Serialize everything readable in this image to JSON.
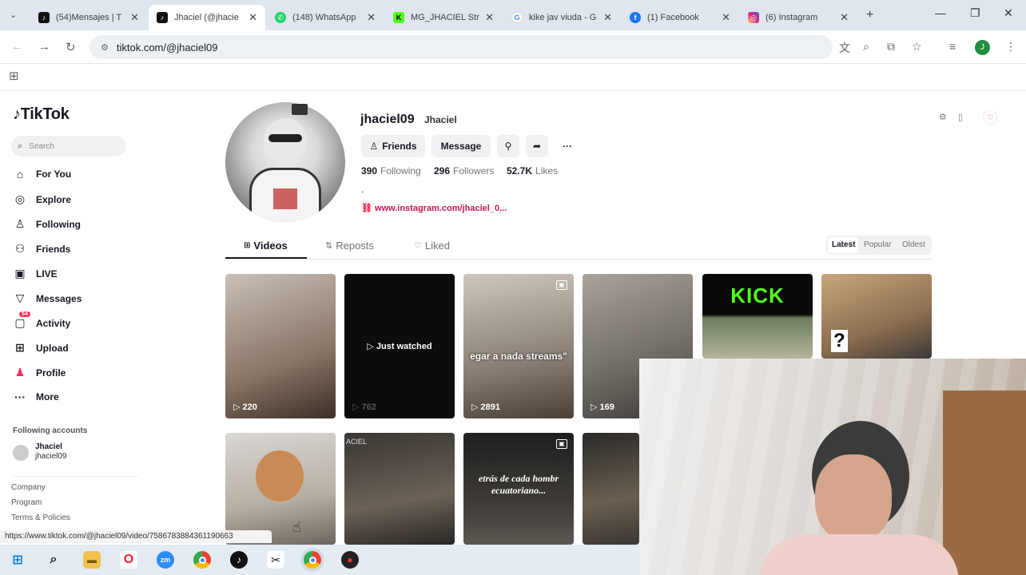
{
  "browser": {
    "tabs": [
      {
        "title": "(54)Mensajes | T",
        "color": "#111"
      },
      {
        "title": "Jhaciel (@jhacie",
        "color": "#111"
      },
      {
        "title": "(148) WhatsApp",
        "color": "#25d366"
      },
      {
        "title": "MG_JHACIEL Str",
        "color": "#53fc18"
      },
      {
        "title": "kike jav viuda - G",
        "color": "#4285f4"
      },
      {
        "title": "(1) Facebook",
        "color": "#1877f2"
      },
      {
        "title": "(6) Instagram",
        "color": "#d62976"
      }
    ],
    "url": "tiktok.com/@jhaciel09",
    "profile_initial": "J",
    "status_url": "https://www.tiktok.com/@jhaciel09/video/7586783884361190663"
  },
  "sidebar": {
    "logo": "TikTok",
    "search_placeholder": "Search",
    "items": [
      {
        "label": "For You",
        "icon": "home-icon"
      },
      {
        "label": "Explore",
        "icon": "compass-icon"
      },
      {
        "label": "Following",
        "icon": "following-icon"
      },
      {
        "label": "Friends",
        "icon": "friends-icon"
      },
      {
        "label": "LIVE",
        "icon": "live-icon"
      },
      {
        "label": "Messages",
        "icon": "messages-icon"
      },
      {
        "label": "Activity",
        "icon": "activity-icon"
      },
      {
        "label": "Upload",
        "icon": "upload-icon"
      },
      {
        "label": "Profile",
        "icon": "profile-icon"
      },
      {
        "label": "More",
        "icon": "more-icon"
      }
    ],
    "activity_badge": "54",
    "following_accounts_heading": "Following accounts",
    "account": {
      "name": "Jhaciel",
      "handle": "jhaciel09"
    },
    "footer_links": [
      "Company",
      "Program",
      "Terms & Policies"
    ]
  },
  "profile": {
    "username": "jhaciel09",
    "display_name": "Jhaciel",
    "friends_button": "Friends",
    "message_button": "Message",
    "following_count": "390",
    "following_label": "Following",
    "followers_count": "296",
    "followers_label": "Followers",
    "likes_count": "52.7K",
    "likes_label": "Likes",
    "bio": ".",
    "link": "www.instagram.com/jhaciel_0..."
  },
  "content_tabs": [
    "Videos",
    "Reposts",
    "Liked"
  ],
  "sort_options": [
    "Latest",
    "Popular",
    "Oldest"
  ],
  "videos": [
    {
      "views": "220",
      "overlay": ""
    },
    {
      "views": "762",
      "overlay": "Just watched"
    },
    {
      "views": "2891",
      "overlay": "egar a nada streams\""
    },
    {
      "views": "169",
      "overlay": ""
    },
    {
      "views": "",
      "overlay": "KICK"
    },
    {
      "views": "",
      "overlay": "?"
    },
    {
      "views": "",
      "overlay": ""
    },
    {
      "views": "",
      "overlay": "ACIEL"
    },
    {
      "views": "",
      "overlay": "etrás de cada hombr ecuatoriano..."
    },
    {
      "views": "",
      "overlay": ""
    }
  ]
}
